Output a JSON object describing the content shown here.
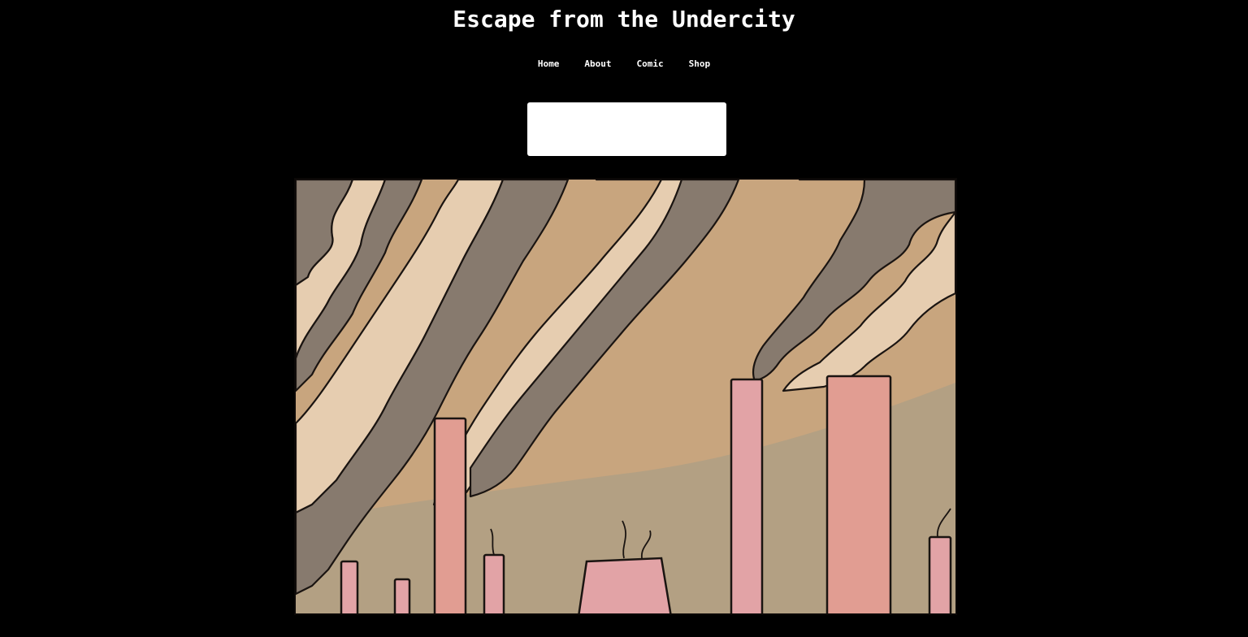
{
  "site": {
    "title": "Escape from the Undercity"
  },
  "nav": {
    "items": [
      {
        "label": "Home"
      },
      {
        "label": "About"
      },
      {
        "label": "Comic"
      },
      {
        "label": "Shop"
      }
    ]
  },
  "colors": {
    "background": "#000000",
    "text": "#ffffff",
    "smoke_dark": "#877a6e",
    "smoke_tan": "#c8a57e",
    "smoke_light": "#e6cdb0",
    "chimney_pink": "#e19d92",
    "ground_olive": "#b3a083",
    "outline": "#1a1411"
  },
  "comic": {
    "scene": "smokestacks-panel"
  }
}
